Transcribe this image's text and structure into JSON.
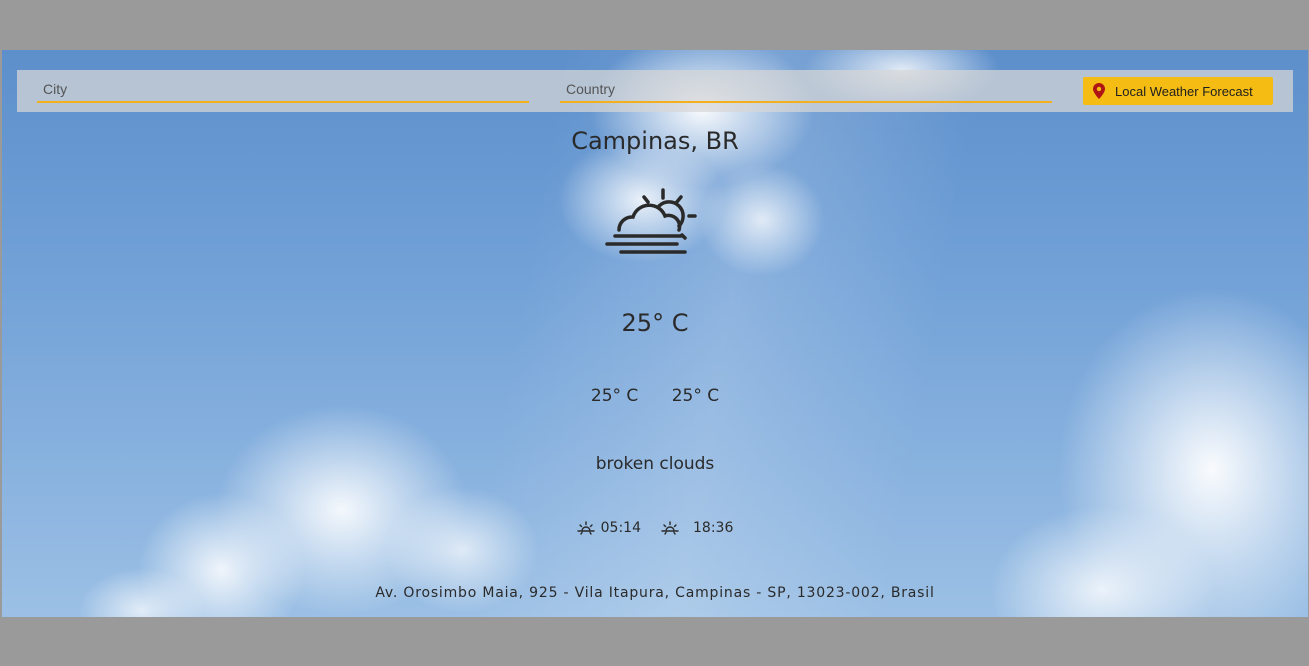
{
  "search": {
    "city_placeholder": "City",
    "country_placeholder": "Country",
    "city_value": "",
    "country_value": "",
    "button_label": "Local Weather Forecast",
    "button_icon": "map-pin-icon"
  },
  "weather": {
    "location": "Campinas, BR",
    "condition_icon": "partly-cloudy-fog-icon",
    "temperature": "25° C",
    "temp_min": "25° C",
    "temp_max": "25° C",
    "description": "broken clouds",
    "sunrise": "05:14",
    "sunset": "18:36",
    "sunrise_icon": "sunrise-icon",
    "sunset_icon": "sunset-icon"
  },
  "address": "Av. Orosimbo Maia, 925 - Vila Itapura, Campinas - SP, 13023-002, Brasil",
  "colors": {
    "accent": "#f5bc14",
    "input_underline": "#f2b01e",
    "pin": "#b01515",
    "text": "#2a2a2a",
    "sky": "#6f9fd6"
  }
}
